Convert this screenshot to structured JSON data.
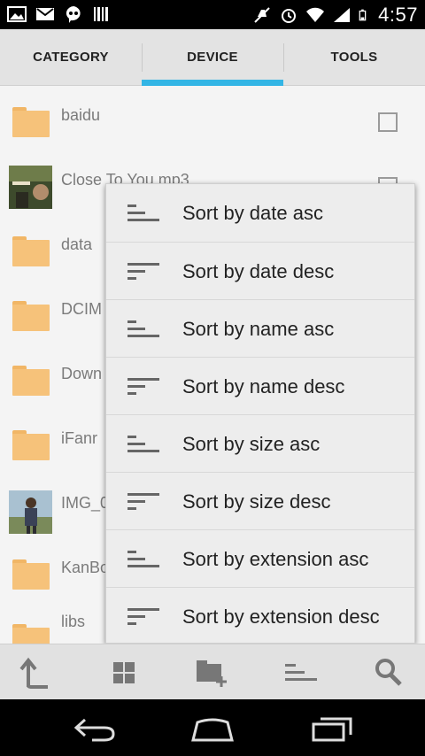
{
  "status_bar": {
    "time": "4:57",
    "left_icons": [
      "gallery-icon",
      "gmail-icon",
      "hangouts-icon",
      "barcode-icon"
    ],
    "right_icons": [
      "mute-icon",
      "alarm-icon",
      "wifi-icon",
      "signal-icon",
      "battery-icon"
    ]
  },
  "tabs": [
    {
      "label": "CATEGORY",
      "active": false
    },
    {
      "label": "DEVICE",
      "active": true
    },
    {
      "label": "TOOLS",
      "active": false
    }
  ],
  "files": [
    {
      "name": "baidu",
      "type": "folder"
    },
    {
      "name": "Close To You.mp3",
      "type": "audio"
    },
    {
      "name": "data",
      "type": "folder"
    },
    {
      "name": "DCIM",
      "type": "folder"
    },
    {
      "name": "Down",
      "type": "folder"
    },
    {
      "name": "iFanr",
      "type": "folder"
    },
    {
      "name": "IMG_0",
      "type": "image"
    },
    {
      "name": "KanBo",
      "type": "folder"
    },
    {
      "name": "libs",
      "type": "folder"
    }
  ],
  "sort_menu": [
    {
      "label": "Sort by date asc",
      "icon": "sort-asc-icon"
    },
    {
      "label": "Sort by date desc",
      "icon": "sort-desc-icon"
    },
    {
      "label": "Sort by name asc",
      "icon": "sort-asc-icon"
    },
    {
      "label": "Sort by name desc",
      "icon": "sort-desc-icon"
    },
    {
      "label": "Sort by size asc",
      "icon": "sort-asc-icon"
    },
    {
      "label": "Sort by size desc",
      "icon": "sort-desc-icon"
    },
    {
      "label": "Sort by extension asc",
      "icon": "sort-asc-icon"
    },
    {
      "label": "Sort by extension desc",
      "icon": "sort-desc-icon"
    }
  ],
  "toolbar": [
    "up-icon",
    "grid-view-icon",
    "new-folder-icon",
    "sort-icon",
    "search-icon"
  ],
  "nav": [
    "back-icon",
    "home-icon",
    "recents-icon"
  ],
  "colors": {
    "accent": "#33b5e5",
    "folder": "#f6c27a",
    "text_secondary": "#7b7b7b"
  }
}
